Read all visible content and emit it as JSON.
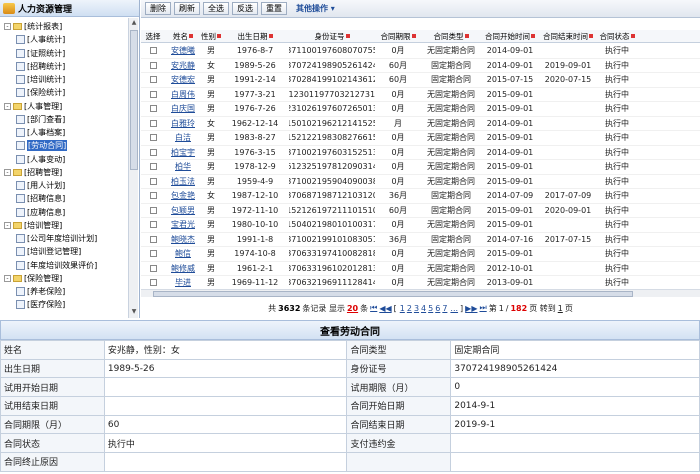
{
  "sidebar": {
    "title": "人力资源管理",
    "items": [
      {
        "label": "[统计报表]",
        "type": "group",
        "expander": "-"
      },
      {
        "label": "[人事统计]",
        "type": "page"
      },
      {
        "label": "[证照统计]",
        "type": "page"
      },
      {
        "label": "[招聘统计]",
        "type": "page"
      },
      {
        "label": "[培训统计]",
        "type": "page"
      },
      {
        "label": "[保险统计]",
        "type": "page"
      },
      {
        "label": "[人事管理]",
        "type": "group",
        "expander": "-"
      },
      {
        "label": "[部门查看]",
        "type": "page"
      },
      {
        "label": "[人事档案]",
        "type": "page"
      },
      {
        "label": "[劳动合同]",
        "type": "page",
        "selected": true
      },
      {
        "label": "[人事变动]",
        "type": "page"
      },
      {
        "label": "[招聘管理]",
        "type": "group",
        "expander": "-"
      },
      {
        "label": "[用人计划]",
        "type": "page"
      },
      {
        "label": "[招聘信息]",
        "type": "page"
      },
      {
        "label": "[应聘信息]",
        "type": "page"
      },
      {
        "label": "[培训管理]",
        "type": "group",
        "expander": "-"
      },
      {
        "label": "[公司年度培训计划]",
        "type": "page"
      },
      {
        "label": "[培训登记管理]",
        "type": "page"
      },
      {
        "label": "[年度培训效果评价]",
        "type": "page"
      },
      {
        "label": "[保险管理]",
        "type": "group",
        "expander": "-"
      },
      {
        "label": "[养老保险]",
        "type": "page"
      },
      {
        "label": "[医疗保险]",
        "type": "page"
      }
    ]
  },
  "toolbar": {
    "delete": "删除",
    "refresh": "刷新",
    "select_all": "全选",
    "invert": "反选",
    "reset": "重置",
    "more": "其他操作"
  },
  "grid": {
    "columns": [
      "选择",
      "姓名",
      "性别",
      "出生日期",
      "身份证号",
      "合同期限",
      "合同类型",
      "合同开始时间",
      "合同结束时间",
      "合同状态"
    ],
    "rows": [
      [
        "安德曦",
        "男",
        "1976-8-7",
        "371100197608070755",
        "0月",
        "无固定期合同",
        "2014-09-01",
        "",
        "执行中"
      ],
      [
        "安兆静",
        "女",
        "1989-5-26",
        "370724198905261424",
        "60月",
        "固定期合同",
        "2014-09-01",
        "2019-09-01",
        "执行中"
      ],
      [
        "安德宏",
        "男",
        "1991-2-14",
        "370284199102143612",
        "60月",
        "固定期合同",
        "2015-07-15",
        "2020-07-15",
        "执行中"
      ],
      [
        "白周伟",
        "男",
        "1977-3-21",
        "612301197703212731X",
        "0月",
        "无固定期合同",
        "2015-09-01",
        "",
        "执行中"
      ],
      [
        "白庆国",
        "男",
        "1976-7-26",
        "231026197607265013",
        "0月",
        "无固定期合同",
        "2015-09-01",
        "",
        "执行中"
      ],
      [
        "白雅玲",
        "女",
        "1962-12-14",
        "150102196212141525",
        "月",
        "无固定期合同",
        "2014-09-01",
        "",
        "执行中"
      ],
      [
        "白洁",
        "男",
        "1983-8-27",
        "152122198308276615",
        "0月",
        "无固定期合同",
        "2015-09-01",
        "",
        "执行中"
      ],
      [
        "柏宝宇",
        "男",
        "1976-3-15",
        "371002197603152513",
        "0月",
        "无固定期合同",
        "2014-09-01",
        "",
        "执行中"
      ],
      [
        "柏华",
        "男",
        "1978-12-9",
        "612325197812090314",
        "0月",
        "无固定期合同",
        "2015-09-01",
        "",
        "执行中"
      ],
      [
        "柏玉法",
        "男",
        "1959-4-9",
        "371002195904090038",
        "0月",
        "无固定期合同",
        "2015-09-01",
        "",
        "执行中"
      ],
      [
        "包金艳",
        "女",
        "1987-12-10",
        "370687198712103120",
        "36月",
        "固定期合同",
        "2014-07-09",
        "2017-07-09",
        "执行中"
      ],
      [
        "包颖男",
        "男",
        "1972-11-10",
        "152126197211101510",
        "60月",
        "固定期合同",
        "2015-09-01",
        "2020-09-01",
        "执行中"
      ],
      [
        "宝君光",
        "男",
        "1980-10-10",
        "150402198010100317",
        "0月",
        "无固定期合同",
        "2015-09-01",
        "",
        "执行中"
      ],
      [
        "鲍晓杰",
        "男",
        "1991-1-8",
        "371002199101083051",
        "36月",
        "固定期合同",
        "2014-07-16",
        "2017-07-15",
        "执行中"
      ],
      [
        "鲍信",
        "男",
        "1974-10-8",
        "370633197410082818",
        "0月",
        "无固定期合同",
        "2015-09-01",
        "",
        "执行中"
      ],
      [
        "鲍修威",
        "男",
        "1961-2-1",
        "370633196102012813",
        "0月",
        "无固定期合同",
        "2012-10-01",
        "",
        "执行中"
      ],
      [
        "毕进",
        "男",
        "1969-11-12",
        "370632196911128414",
        "0月",
        "无固定期合同",
        "2013-09-01",
        "",
        "执行中"
      ]
    ]
  },
  "pager": {
    "prefix": "共",
    "total": "3632",
    "records": "条记录 显示",
    "per_page": "20",
    "per_unit": "条",
    "nav_first": "⏮",
    "nav_prev": "◀◀",
    "bracket_open": "[",
    "pages": [
      "1",
      "2",
      "3",
      "4",
      "5",
      "6",
      "7"
    ],
    "ellipsis": "...",
    "bracket_close": "]",
    "nav_next": "▶▶",
    "nav_last": "⏭",
    "page_prefix": "第",
    "current": "1",
    "slash": "/",
    "page_total": "182",
    "page_suffix": "页 转到",
    "goto": "1",
    "goto_suffix": "页"
  },
  "detail": {
    "title": "查看劳动合同",
    "rows": [
      [
        {
          "k": "姓名"
        },
        {
          "v": "安兆静，性别：女"
        },
        {
          "k": "合同类型"
        },
        {
          "v": "固定期合同"
        }
      ],
      [
        {
          "k": "出生日期"
        },
        {
          "v": "1989-5-26"
        },
        {
          "k": "身份证号"
        },
        {
          "v": "370724198905261424"
        }
      ],
      [
        {
          "k": "试用开始日期"
        },
        {
          "v": ""
        },
        {
          "k": "试用期限（月）"
        },
        {
          "v": "0"
        }
      ],
      [
        {
          "k": "试用结束日期"
        },
        {
          "v": ""
        },
        {
          "k": "合同开始日期"
        },
        {
          "v": "2014-9-1"
        }
      ],
      [
        {
          "k": "合同期限（月）"
        },
        {
          "v": "60"
        },
        {
          "k": "合同结束日期"
        },
        {
          "v": "2019-9-1"
        }
      ],
      [
        {
          "k": "合同状态"
        },
        {
          "v": "执行中"
        },
        {
          "k": "支付违约金"
        },
        {
          "v": ""
        }
      ],
      [
        {
          "k": "合同终止原因"
        },
        {
          "v": ""
        },
        {
          "k": ""
        },
        {
          "v": ""
        }
      ]
    ]
  }
}
